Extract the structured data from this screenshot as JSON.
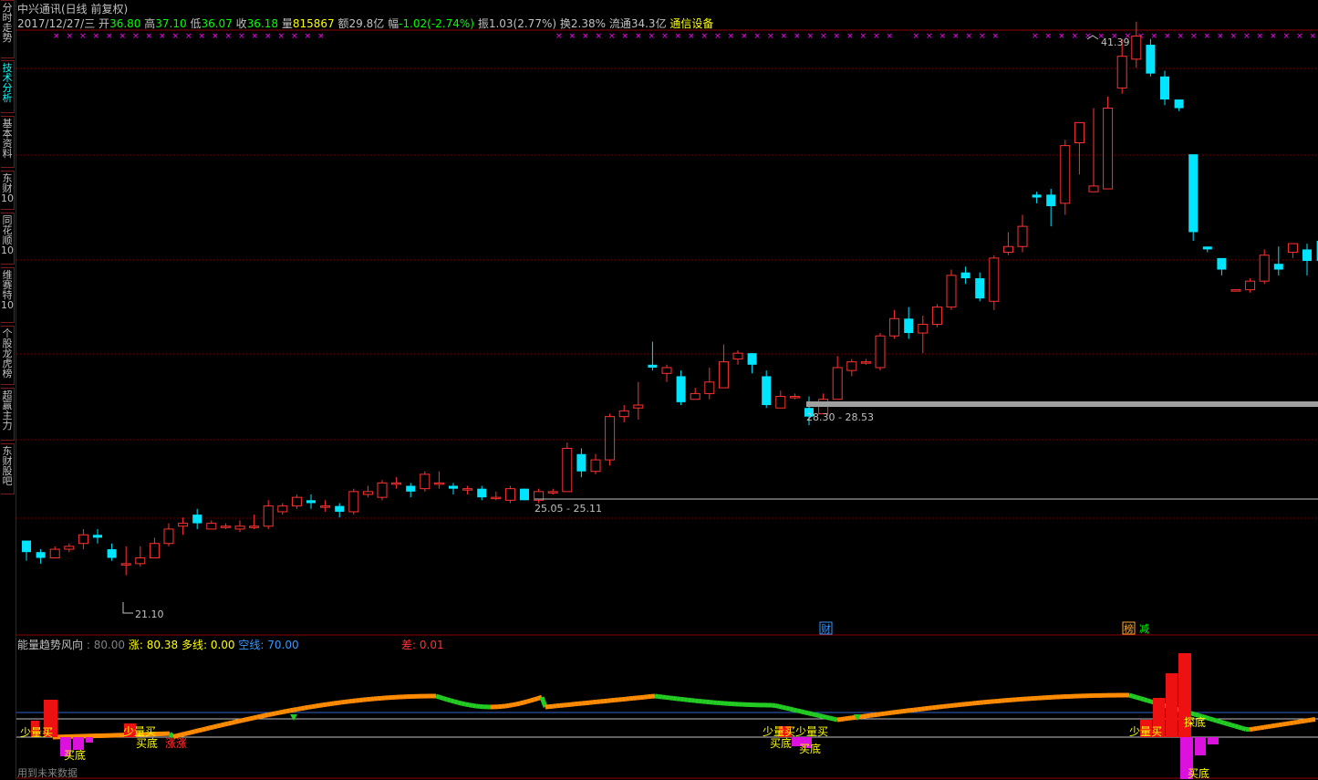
{
  "sidebar": {
    "tabs": [
      {
        "label": "分时走势",
        "active": false
      },
      {
        "label": "技术分析",
        "active": true
      },
      {
        "label": "基本资料",
        "active": false
      },
      {
        "label": "东财10",
        "active": false
      },
      {
        "label": "同花顺10",
        "active": false
      },
      {
        "label": "维赛特10",
        "active": false
      },
      {
        "label": "个股龙虎榜",
        "active": false
      },
      {
        "label": "超赢主力",
        "active": false
      },
      {
        "label": "东财股吧",
        "active": false
      }
    ]
  },
  "header": {
    "title": "中兴通讯(日线 前复权)",
    "date": "2017/12/27/三",
    "open_label": "开",
    "open": "36.80",
    "high_label": "高",
    "high": "37.10",
    "low_label": "低",
    "low": "36.07",
    "close_label": "收",
    "close": "36.18",
    "vol_label": "量",
    "vol": "815867",
    "amt_label": "额",
    "amt": "29.8亿",
    "chg_label": "幅",
    "chg": "-1.02(-2.74%)",
    "amp_label": "振",
    "amp": "1.03(2.77%)",
    "turn_label": "换",
    "turn": "2.38%",
    "float_label": "流通",
    "float": "34.3亿",
    "sector": "通信设备"
  },
  "annotations": {
    "high_label": "41.39",
    "low_label": "21.10",
    "range1": "28.30 - 28.53",
    "range2": "25.05 - 25.11",
    "event_cai": "财",
    "event_bang": "榜",
    "event_jian": "减"
  },
  "indicator": {
    "name": "能量趋势风向",
    "value_main": ": 80.00",
    "zhang_label": "涨:",
    "zhang": "80.38",
    "duo_label": "多线:",
    "duo": "0.00",
    "kong_label": "空线:",
    "kong": "70.00",
    "cha_label": "差:",
    "cha": "0.01",
    "signals": [
      "少量买",
      "买底",
      "少量买",
      "买底",
      "涨涨",
      "少量买少量买",
      "买底",
      "买底",
      "少量买",
      "探底",
      "买底"
    ]
  },
  "footer": {
    "note": "用到未来数据"
  },
  "colors": {
    "up": "#ff3232",
    "down": "#00e5ff",
    "grid": "#8b0000",
    "magenta": "#ff00ff"
  },
  "chart_data": {
    "type": "candlestick",
    "ylim": [
      20.0,
      42.0
    ],
    "candles": [
      [
        23.4,
        23.0,
        23.4,
        22.7
      ],
      [
        23.0,
        22.8,
        23.1,
        22.6
      ],
      [
        22.8,
        23.1,
        23.2,
        22.8
      ],
      [
        23.1,
        23.2,
        23.3,
        23.0
      ],
      [
        23.3,
        23.6,
        23.8,
        23.1
      ],
      [
        23.6,
        23.5,
        23.8,
        23.3
      ],
      [
        23.1,
        22.8,
        23.3,
        22.7
      ],
      [
        22.6,
        22.6,
        23.2,
        22.2
      ],
      [
        22.6,
        22.8,
        23.2,
        22.5
      ],
      [
        22.8,
        23.3,
        23.5,
        22.8
      ],
      [
        23.3,
        23.8,
        24.0,
        23.2
      ],
      [
        23.9,
        24.0,
        24.2,
        23.6
      ],
      [
        24.3,
        24.0,
        24.5,
        23.8
      ],
      [
        23.8,
        24.0,
        24.1,
        23.8
      ],
      [
        23.9,
        23.9,
        24.0,
        23.8
      ],
      [
        23.8,
        23.9,
        24.1,
        23.7
      ],
      [
        23.9,
        23.9,
        24.3,
        23.8
      ],
      [
        23.9,
        24.6,
        24.8,
        23.8
      ],
      [
        24.4,
        24.6,
        24.7,
        24.3
      ],
      [
        24.6,
        24.9,
        25.0,
        24.5
      ],
      [
        24.8,
        24.7,
        25.0,
        24.5
      ],
      [
        24.6,
        24.6,
        24.8,
        24.4
      ],
      [
        24.6,
        24.4,
        24.7,
        24.2
      ],
      [
        24.4,
        25.1,
        25.2,
        24.3
      ],
      [
        25.0,
        25.1,
        25.3,
        24.9
      ],
      [
        24.9,
        25.4,
        25.5,
        24.8
      ],
      [
        25.4,
        25.4,
        25.6,
        25.2
      ],
      [
        25.3,
        25.1,
        25.4,
        24.9
      ],
      [
        25.2,
        25.7,
        25.8,
        25.1
      ],
      [
        25.4,
        25.4,
        25.8,
        25.2
      ],
      [
        25.3,
        25.2,
        25.4,
        25.0
      ],
      [
        25.2,
        25.2,
        25.3,
        25.0
      ],
      [
        25.2,
        24.9,
        25.3,
        24.8
      ],
      [
        24.9,
        24.9,
        25.1,
        24.8
      ],
      [
        24.8,
        25.2,
        25.3,
        24.7
      ],
      [
        25.2,
        24.8,
        25.2,
        24.8
      ],
      [
        24.8,
        25.1,
        25.2,
        24.7
      ],
      [
        25.1,
        25.1,
        25.2,
        25.0
      ],
      [
        25.1,
        26.6,
        26.8,
        25.1
      ],
      [
        26.4,
        25.8,
        26.6,
        25.6
      ],
      [
        25.8,
        26.2,
        26.4,
        25.7
      ],
      [
        26.2,
        27.7,
        27.8,
        26.0
      ],
      [
        27.7,
        27.9,
        28.1,
        27.5
      ],
      [
        28.0,
        28.1,
        28.9,
        27.6
      ],
      [
        29.5,
        29.4,
        30.3,
        29.3
      ],
      [
        29.2,
        29.4,
        29.5,
        28.9
      ],
      [
        29.1,
        28.2,
        29.3,
        28.1
      ],
      [
        28.3,
        28.5,
        28.7,
        28.3
      ],
      [
        28.5,
        28.9,
        29.4,
        28.3
      ],
      [
        28.7,
        29.6,
        30.2,
        28.7
      ],
      [
        29.7,
        29.9,
        30.0,
        29.5
      ],
      [
        29.9,
        29.5,
        29.9,
        29.2
      ],
      [
        29.1,
        28.1,
        29.3,
        28.0
      ],
      [
        28.0,
        28.4,
        28.6,
        28.0
      ],
      [
        28.4,
        28.4,
        28.5,
        28.3
      ],
      [
        28.0,
        27.7,
        28.4,
        27.4
      ],
      [
        27.8,
        28.3,
        28.5,
        27.8
      ],
      [
        28.3,
        29.4,
        29.8,
        28.3
      ],
      [
        29.3,
        29.6,
        29.7,
        29.1
      ],
      [
        29.6,
        29.6,
        29.7,
        29.5
      ],
      [
        29.4,
        30.5,
        30.6,
        29.3
      ],
      [
        30.5,
        31.1,
        31.4,
        30.4
      ],
      [
        31.1,
        30.6,
        31.5,
        30.4
      ],
      [
        30.6,
        30.9,
        31.2,
        29.9
      ],
      [
        30.9,
        31.5,
        31.6,
        30.8
      ],
      [
        31.5,
        32.6,
        32.8,
        31.4
      ],
      [
        32.7,
        32.5,
        32.9,
        32.3
      ],
      [
        32.5,
        31.8,
        32.7,
        31.7
      ],
      [
        31.7,
        33.2,
        33.3,
        31.4
      ],
      [
        33.4,
        33.6,
        34.1,
        33.3
      ],
      [
        33.6,
        34.3,
        34.7,
        33.4
      ],
      [
        35.4,
        35.3,
        35.5,
        35.1
      ],
      [
        35.4,
        35.0,
        35.6,
        34.3
      ],
      [
        35.1,
        37.1,
        37.3,
        34.7
      ],
      [
        37.2,
        37.9,
        37.9,
        36.1
      ],
      [
        35.5,
        35.7,
        38.4,
        35.5
      ],
      [
        35.6,
        38.4,
        38.8,
        35.6
      ],
      [
        39.1,
        40.2,
        40.8,
        38.9
      ],
      [
        40.1,
        40.9,
        41.4,
        39.8
      ],
      [
        40.6,
        39.6,
        40.8,
        39.5
      ],
      [
        39.5,
        38.7,
        39.7,
        38.5
      ],
      [
        38.7,
        38.4,
        38.7,
        38.3
      ],
      [
        36.8,
        34.1,
        36.8,
        33.8
      ],
      [
        33.6,
        33.5,
        33.6,
        33.4
      ],
      [
        33.2,
        32.8,
        33.2,
        32.6
      ],
      [
        32.1,
        32.1,
        32.1,
        32.1
      ],
      [
        32.1,
        32.4,
        32.5,
        32.0
      ],
      [
        32.4,
        33.3,
        33.5,
        32.3
      ],
      [
        33.0,
        32.8,
        33.6,
        32.6
      ],
      [
        33.4,
        33.7,
        33.7,
        33.2
      ],
      [
        33.5,
        33.1,
        33.7,
        32.6
      ],
      [
        33.8,
        33.1,
        33.8,
        32.7
      ],
      [
        33.9,
        35.3,
        35.3,
        33.2
      ],
      [
        35.4,
        36.0,
        36.1,
        35.1
      ],
      [
        36.8,
        36.2,
        37.1,
        36.1
      ]
    ]
  }
}
